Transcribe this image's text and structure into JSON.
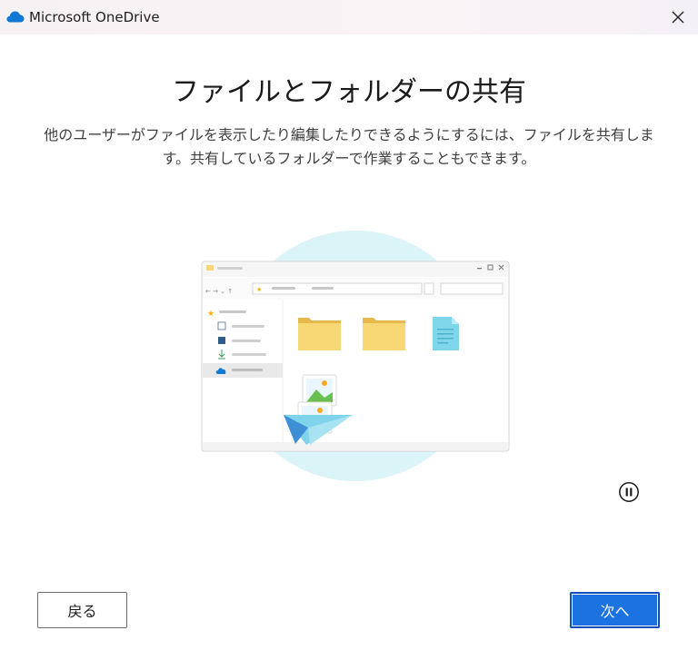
{
  "window": {
    "title": "Microsoft OneDrive",
    "close_icon": "close-icon",
    "app_icon": "onedrive-cloud-icon"
  },
  "content": {
    "heading": "ファイルとフォルダーの共有",
    "description": "他のユーザーがファイルを表示したり編集したりできるようにするには、ファイルを共有します。共有しているフォルダーで作業することもできます。"
  },
  "illustration": {
    "pause_icon": "pause-icon"
  },
  "buttons": {
    "back_label": "戻る",
    "next_label": "次へ"
  },
  "colors": {
    "accent": "#1a73e0",
    "cloud_blue": "#0f78d4",
    "circle": "#daf4f8",
    "folder": "#f8d775"
  }
}
